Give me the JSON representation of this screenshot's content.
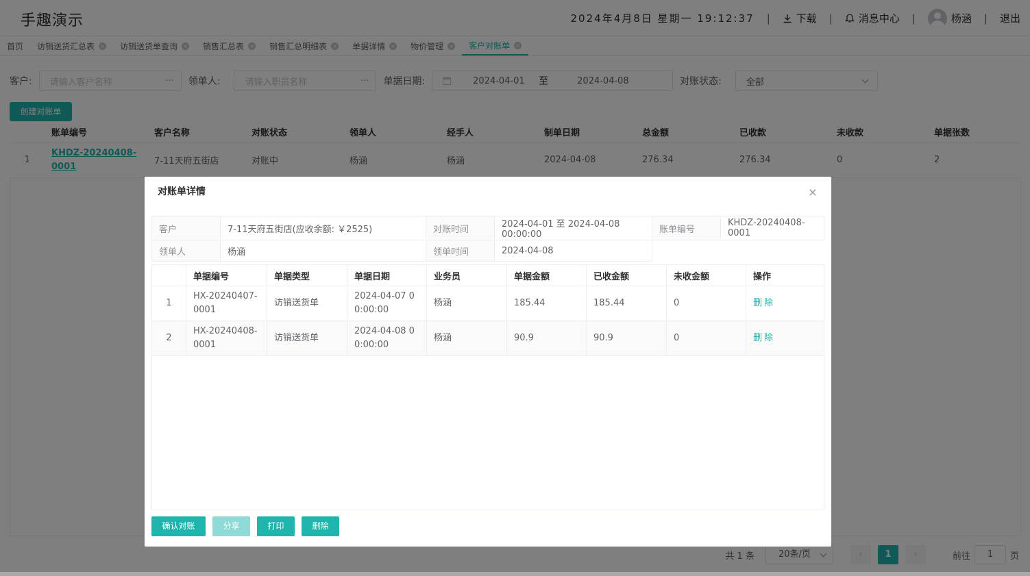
{
  "header": {
    "app_title": "手趣演示",
    "datetime": "2024年4月8日 星期一 19:12:37",
    "download": "下载",
    "messages": "消息中心",
    "user": "杨涵",
    "logout": "退出",
    "separator": "|"
  },
  "tabs": [
    {
      "label": "首页"
    },
    {
      "label": "访销送货汇总表"
    },
    {
      "label": "访销送货单查询"
    },
    {
      "label": "销售汇总表"
    },
    {
      "label": "销售汇总明细表"
    },
    {
      "label": "单据详情"
    },
    {
      "label": "物价管理"
    },
    {
      "label": "客户对账单"
    }
  ],
  "filters": {
    "customer_label": "客户:",
    "customer_placeholder": "请输入客户名称",
    "leader_label": "领单人:",
    "leader_placeholder": "请输入职员名称",
    "date_label": "单据日期:",
    "date_from": "2024-04-01",
    "date_to_sep": "至",
    "date_to": "2024-04-08",
    "status_label": "对账状态:",
    "status_value": "全部",
    "more": "···"
  },
  "create_button": "创建对账单",
  "main_table": {
    "headers": [
      "账单编号",
      "客户名称",
      "对账状态",
      "领单人",
      "经手人",
      "制单日期",
      "总金额",
      "已收款",
      "未收款",
      "单据张数"
    ],
    "rows": [
      {
        "idx": "1",
        "code": "KHDZ-20240408-0001",
        "customer": "7-11天府五街店",
        "status": "对账中",
        "leader": "杨涵",
        "handler": "杨涵",
        "date": "2024-04-08",
        "total": "276.34",
        "received": "276.34",
        "unpaid": "0",
        "count": "2"
      }
    ]
  },
  "pager": {
    "total": "共 1 条",
    "page_size": "20条/页",
    "prev": "‹",
    "current": "1",
    "next": "›",
    "goto": "前往",
    "goto_value": "1",
    "page": "页"
  },
  "modal": {
    "title": "对账单详情",
    "close": "×",
    "info": {
      "customer_k": "客户",
      "customer_v": "7-11天府五街店(应收余额: ￥2525)",
      "period_k": "对账时间",
      "period_v": "2024-04-01 至 2024-04-08 00:00:00",
      "code_k": "账单编号",
      "code_v": "KHDZ-20240408-0001",
      "leader_k": "领单人",
      "leader_v": "杨涵",
      "lead_time_k": "领单时间",
      "lead_time_v": "2024-04-08"
    },
    "detail_headers": [
      "单据编号",
      "单据类型",
      "单据日期",
      "业务员",
      "单据金额",
      "已收金额",
      "未收金额",
      "操作"
    ],
    "detail_rows": [
      {
        "idx": "1",
        "code": "HX-20240407-0001",
        "type": "访销送货单",
        "date": "2024-04-07 00:00:00",
        "salesman": "杨涵",
        "amount": "185.44",
        "received": "185.44",
        "unpaid": "0",
        "action": "删除"
      },
      {
        "idx": "2",
        "code": "HX-20240408-0001",
        "type": "访销送货单",
        "date": "2024-04-08 00:00:00",
        "salesman": "杨涵",
        "amount": "90.9",
        "received": "90.9",
        "unpaid": "0",
        "action": "删除"
      }
    ],
    "buttons": {
      "confirm": "确认对账",
      "share": "分享",
      "print": "打印",
      "delete": "删除"
    }
  },
  "colors": {
    "accent": "#1fb5ad",
    "danger": "#f56c6c"
  }
}
